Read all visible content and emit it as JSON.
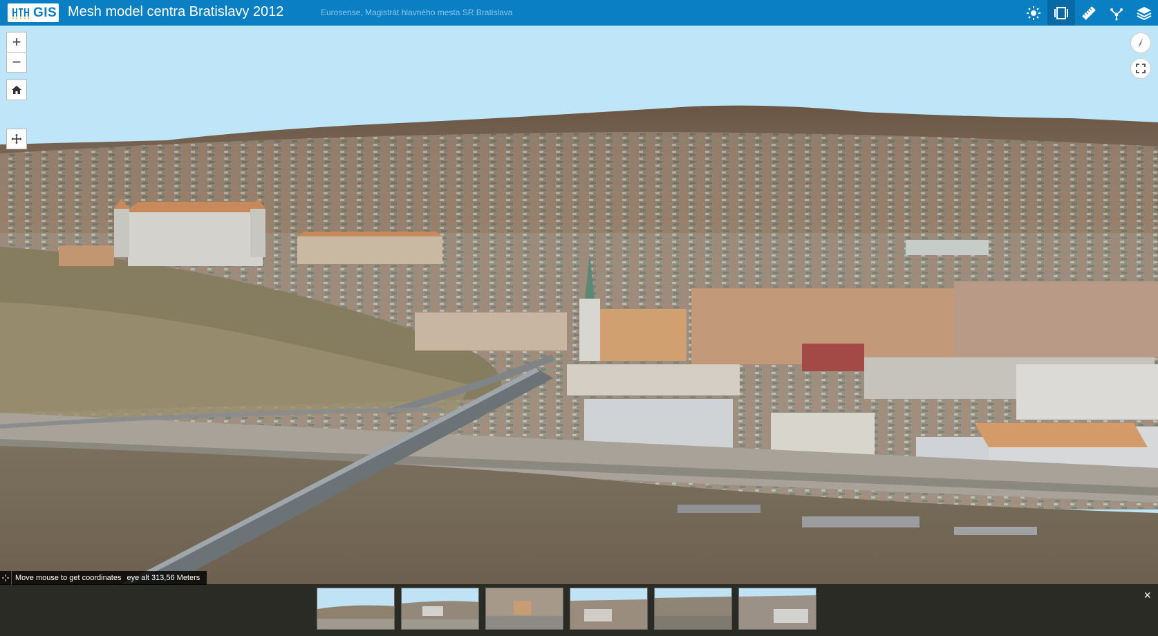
{
  "header": {
    "logo_text": "GIS",
    "title": "Mesh model centra Bratislavy 2012",
    "subtitle": "Eurosense, Magistrát hlavného mesta SR Bratislava",
    "tools": [
      {
        "name": "daylight-icon"
      },
      {
        "name": "slides-icon",
        "active": true
      },
      {
        "name": "measure-icon"
      },
      {
        "name": "share-icon"
      },
      {
        "name": "layers-icon"
      }
    ]
  },
  "map_controls": {
    "zoom_in": "+",
    "zoom_out": "−",
    "home": "home-icon",
    "navigation": "pan-icon",
    "compass": "compass-icon",
    "fullscreen": "fullscreen-icon"
  },
  "status_bar": {
    "coordinates_text": "Move mouse to get coordinates",
    "eye_alt_text": "eye alt 313,56 Meters"
  },
  "slides": {
    "count": 6,
    "close_label": "×"
  },
  "colors": {
    "header_bg": "#0a7fc4",
    "header_active": "#076aa5",
    "sky": "#bfe6f8",
    "strip_bg": "#2b2b25"
  }
}
